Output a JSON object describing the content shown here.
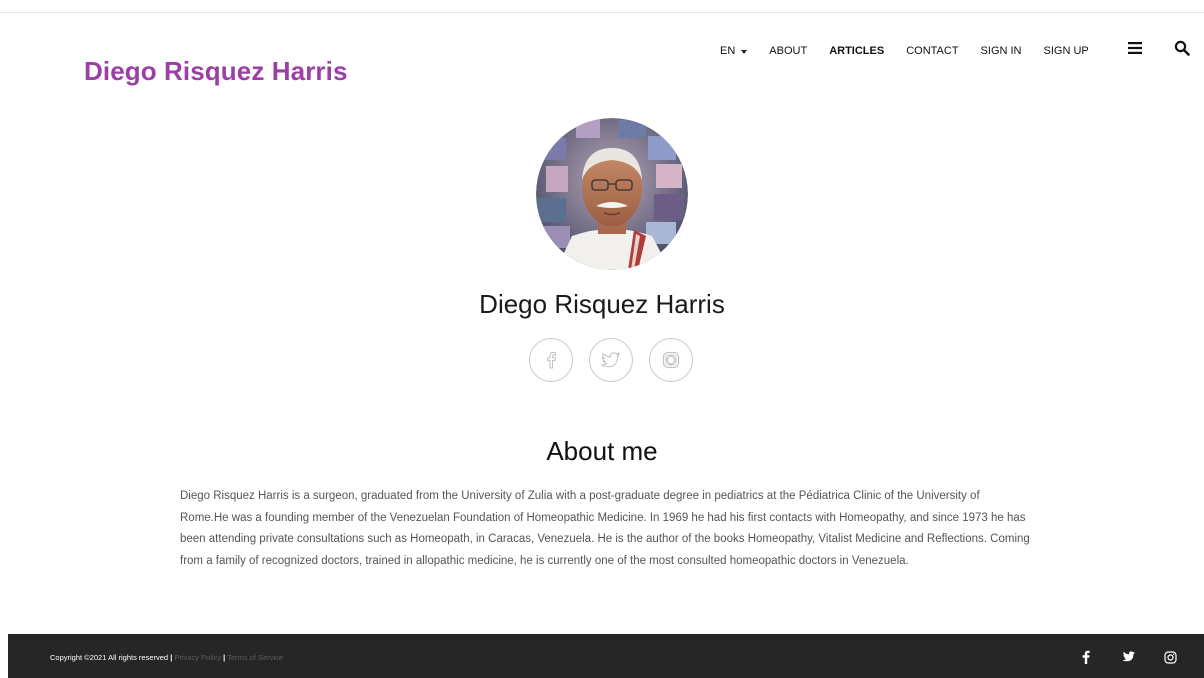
{
  "header": {
    "brand": "Diego Risquez Harris",
    "nav": {
      "language": "EN",
      "items": [
        "ABOUT",
        "ARTICLES",
        "CONTACT",
        "SIGN IN",
        "SIGN UP"
      ],
      "active": "ARTICLES"
    },
    "icons": [
      "menu-icon",
      "search-icon"
    ]
  },
  "profile": {
    "name": "Diego Risquez Harris",
    "avatar_icon": "person-photo",
    "social_icons": [
      "facebook-icon",
      "twitter-icon",
      "instagram-icon"
    ]
  },
  "about": {
    "title": "About me",
    "text": "Diego Risquez Harris is a surgeon, graduated from the University of Zulia with a post-graduate degree in pediatrics at the Pédiatrica Clinic of the University of Rome.He was a founding member of the Venezuelan Foundation of Homeopathic Medicine. In 1969 he had his first contacts with Homeopathy, and since 1973 he has been attending private consultations such as Homeopath, in Caracas, Venezuela. He is the author of the books Homeopathy, Vitalist Medicine and Reflections. Coming from a family of recognized doctors, trained in allopathic medicine, he is currently one of the most consulted homeopathic doctors in Venezuela."
  },
  "footer": {
    "copyright": "Copyright ©2021 All rights reserved",
    "separator": "|",
    "privacy": "Privacy Policy",
    "terms": "Terms of Service",
    "social_icons": [
      "facebook-icon",
      "twitter-icon",
      "instagram-icon"
    ]
  },
  "colors": {
    "brand": "#9b3fa7",
    "footer_bg": "#262626"
  }
}
